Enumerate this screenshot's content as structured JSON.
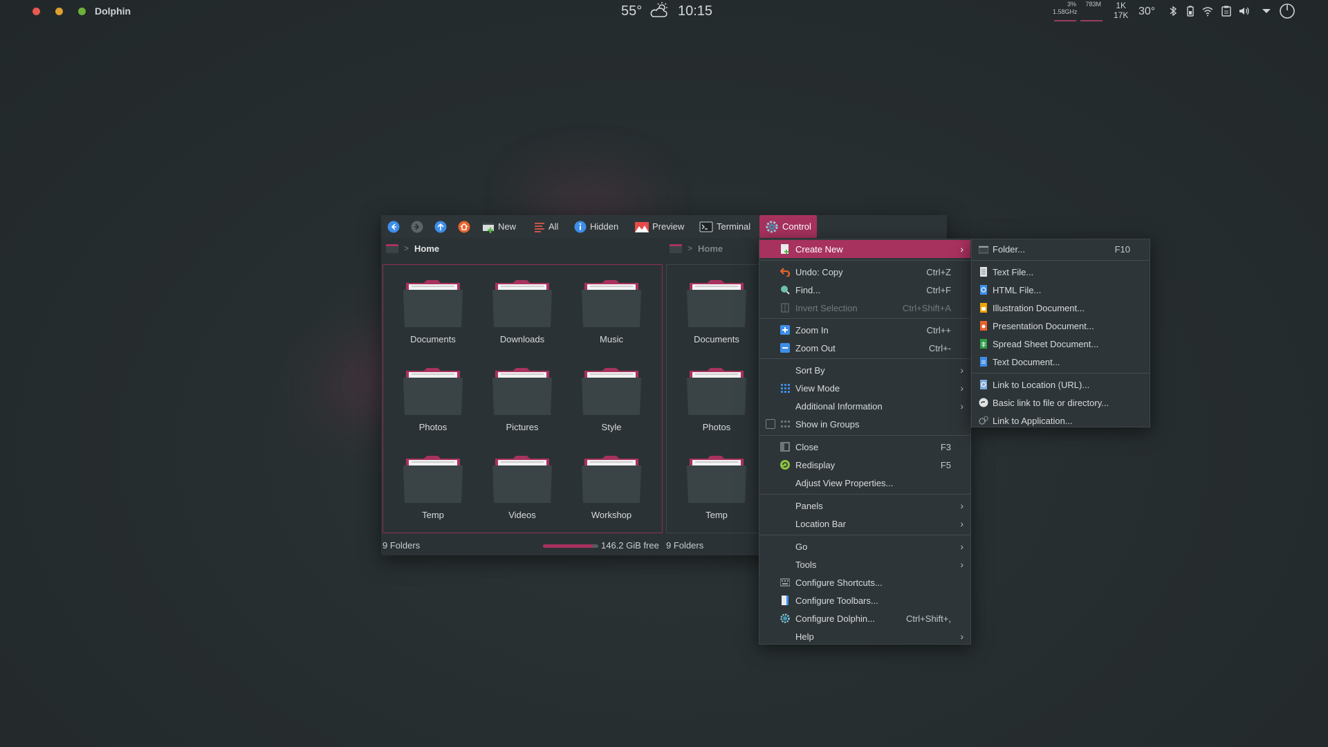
{
  "topbar": {
    "app_title": "Dolphin",
    "weather_temp": "55°",
    "clock": "10:15",
    "cpu_percent": "3%",
    "cpu_freq": "1.58GHz",
    "mem": "783M",
    "net_up": "1K",
    "net_down": "17K",
    "cpu_temp": "30°"
  },
  "toolbar": {
    "new": "New",
    "all": "All",
    "hidden": "Hidden",
    "preview": "Preview",
    "terminal": "Terminal",
    "control": "Control"
  },
  "left_pane": {
    "breadcrumb": "Home",
    "folders": [
      "Documents",
      "Downloads",
      "Music",
      "Photos",
      "Pictures",
      "Style",
      "Temp",
      "Videos",
      "Workshop"
    ],
    "status": "9 Folders",
    "free_space": "146.2 GiB free",
    "used_fraction": 0.9
  },
  "right_pane": {
    "breadcrumb": "Home",
    "folders": [
      "Documents",
      "Photos",
      "Temp"
    ],
    "status": "9 Folders"
  },
  "menu": {
    "create_new": "Create New",
    "undo": "Undo: Copy",
    "undo_sc": "Ctrl+Z",
    "find": "Find...",
    "find_sc": "Ctrl+F",
    "invert": "Invert Selection",
    "invert_sc": "Ctrl+Shift+A",
    "zoom_in": "Zoom In",
    "zoom_in_sc": "Ctrl++",
    "zoom_out": "Zoom Out",
    "zoom_out_sc": "Ctrl+-",
    "sort_by": "Sort By",
    "view_mode": "View Mode",
    "additional_info": "Additional Information",
    "show_in_groups": "Show in Groups",
    "close": "Close",
    "close_sc": "F3",
    "redisplay": "Redisplay",
    "redisplay_sc": "F5",
    "adjust_view": "Adjust View Properties...",
    "panels": "Panels",
    "location_bar": "Location Bar",
    "go": "Go",
    "tools": "Tools",
    "configure_shortcuts": "Configure Shortcuts...",
    "configure_toolbars": "Configure Toolbars...",
    "configure_dolphin": "Configure Dolphin...",
    "configure_dolphin_sc": "Ctrl+Shift+,",
    "help": "Help"
  },
  "submenu": {
    "folder": "Folder...",
    "folder_sc": "F10",
    "text_file": "Text File...",
    "html_file": "HTML File...",
    "illustration": "Illustration Document...",
    "presentation": "Presentation Document...",
    "spreadsheet": "Spread Sheet Document...",
    "text_document": "Text Document...",
    "link_url": "Link to Location (URL)...",
    "basic_link": "Basic link to file or directory...",
    "link_app": "Link to Application..."
  },
  "colors": {
    "accent": "#a8325e",
    "folder_body": "#3a4447",
    "folder_tab": "#a8325e"
  }
}
